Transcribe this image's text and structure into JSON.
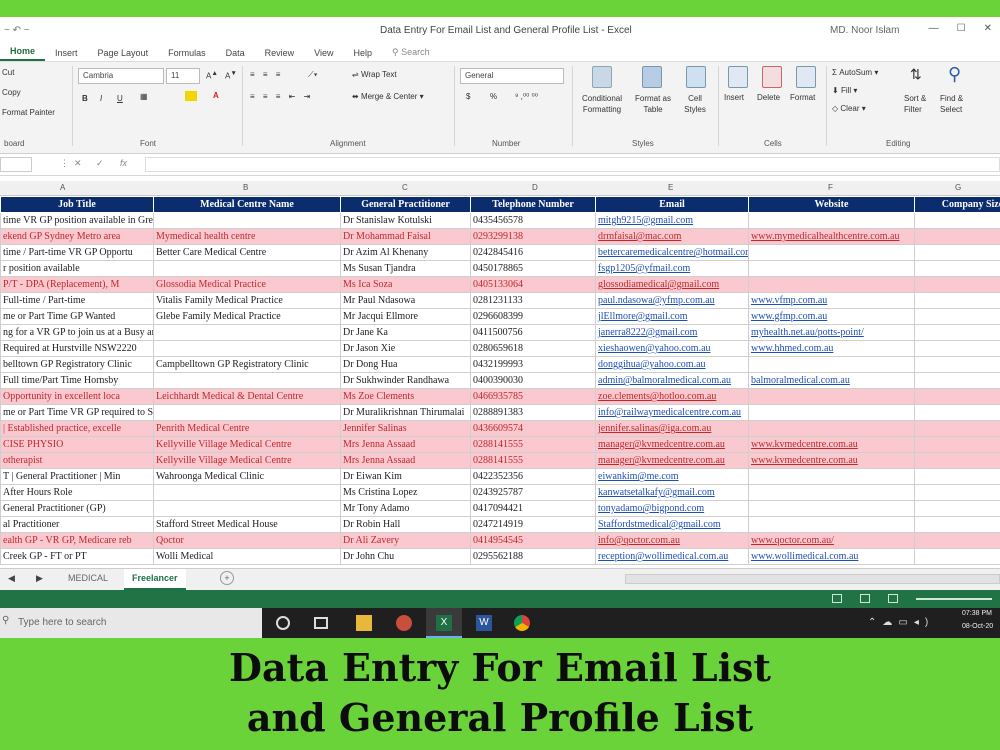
{
  "window": {
    "title": "Data Entry For Email List and General Profile List - Excel",
    "user": "MD. Noor Islam",
    "quick_access": "~ ↶ ~"
  },
  "tabs": [
    "Home",
    "Insert",
    "Page Layout",
    "Formulas",
    "Data",
    "Review",
    "View",
    "Help"
  ],
  "search_label": "Search",
  "ribbon": {
    "clipboard": {
      "cut": "Cut",
      "copy": "Copy",
      "format_painter": "Format Painter",
      "group": "board"
    },
    "font": {
      "name": "Cambria",
      "size": "11",
      "bold": "B",
      "italic": "I",
      "underline": "U",
      "group": "Font"
    },
    "alignment": {
      "wrap": "Wrap Text",
      "merge": "Merge & Center",
      "group": "Alignment"
    },
    "number": {
      "format": "General",
      "currency": "$",
      "percent": "%",
      "group": "Number"
    },
    "styles": {
      "conditional": "Conditional Formatting",
      "format_table": "Format as Table",
      "cell_styles": "Cell Styles",
      "group": "Styles"
    },
    "cells": {
      "insert": "Insert",
      "delete": "Delete",
      "format": "Format",
      "group": "Cells"
    },
    "editing": {
      "autosum": "AutoSum",
      "fill": "Fill",
      "clear": "Clear",
      "sort": "Sort & Filter",
      "find": "Find & Select",
      "group": "Editing"
    }
  },
  "formula_bar": {
    "fx": "fx",
    "cancel": "✕",
    "confirm": "✓"
  },
  "col_letters": [
    "A",
    "B",
    "C",
    "D",
    "E",
    "F",
    "G"
  ],
  "headers": [
    "Job Title",
    "Medical Centre Name",
    "General Practitioner",
    "Telephone Number",
    "Email",
    "Website",
    "Company Size"
  ],
  "rows": [
    {
      "pink": false,
      "cells": [
        "time VR GP position available in Greystanes NSW",
        "",
        "Dr Stanislaw Kotulski",
        "0435456578",
        "mitgh9215@gmail.com",
        "",
        ""
      ]
    },
    {
      "pink": true,
      "cells": [
        "ekend GP Sydney Metro area",
        "Mymedical health centre",
        "Dr Mohammad Faisal",
        "0293299138",
        "drmfaisal@mac.com",
        "www.mymedicalhealthcentre.com.au",
        ""
      ]
    },
    {
      "pink": false,
      "cells": [
        "time / Part-time VR GP Opportu",
        "Better Care Medical Centre",
        "Dr Azim Al Khenany",
        "0242845416",
        "bettercaremedicalcentre@hotmail.com",
        "",
        ""
      ]
    },
    {
      "pink": false,
      "cells": [
        "r position available",
        "",
        "Ms Susan Tjandra",
        "0450178865",
        "fsgp1205@yfmail.com",
        "",
        ""
      ]
    },
    {
      "pink": true,
      "cells": [
        "P/T - DPA (Replacement), M",
        "Glossodia Medical Practice",
        "Ms Ica Soza",
        "0405133064",
        "glossodiamedical@gmail.com",
        "",
        ""
      ]
    },
    {
      "pink": false,
      "cells": [
        "Full-time / Part-time",
        "Vitalis Family Medical Practice",
        "Mr Paul Ndasowa",
        "0281231133",
        "paul.ndasowa@yfmp.com.au",
        "www.vfmp.com.au",
        ""
      ]
    },
    {
      "pink": false,
      "cells": [
        "me or Part Time GP Wanted",
        "Glebe Family Medical Practice",
        "Mr Jacqui Ellmore",
        "0296608399",
        "jlEllmore@gmail.com",
        "www.gfmp.com.au",
        ""
      ]
    },
    {
      "pink": false,
      "cells": [
        "ng for a VR GP to join us at a Busy and Trendy Clinic in POTTS POIN",
        "",
        "Dr Jane Ka",
        "0411500756",
        "janerra8222@gmail.com",
        "myhealth.net.au/potts-point/",
        ""
      ]
    },
    {
      "pink": false,
      "cells": [
        "Required at Hurstville NSW2220",
        "",
        "Dr Jason Xie",
        "0280659618",
        "xieshaowen@yahoo.com.au",
        "www.hhmed.com.au",
        ""
      ]
    },
    {
      "pink": false,
      "cells": [
        "belltown GP Registratory Clinic",
        "Campbelltown GP Registratory Clinic",
        "Dr Dong Hua",
        "0432199993",
        "donggihua@yahoo.com.au",
        "",
        ""
      ]
    },
    {
      "pink": false,
      "cells": [
        "Full time/Part Time Hornsby",
        "",
        "Dr Sukhwinder Randhawa",
        "0400390030",
        "admin@balmoralmedical.com.au",
        "balmoralmedical.com.au",
        ""
      ]
    },
    {
      "pink": true,
      "cells": [
        "Opportunity in excellent loca",
        "Leichhardt Medical & Dental Centre",
        "Ms Zoe Clements",
        "0466935785",
        "zoe.clements@hotloo.com.au",
        "",
        ""
      ]
    },
    {
      "pink": false,
      "cells": [
        "me or Part Time VR GP required to Start Immediately",
        "",
        "Dr Muralikrishnan Thirumalai",
        "0288891383",
        "info@railwaymedicalcentre.com.au",
        "",
        ""
      ]
    },
    {
      "pink": true,
      "cells": [
        "| Established practice, excelle",
        "Penrith Medical Centre",
        "Jennifer Salinas",
        "0436609574",
        "jennifer.salinas@iga.com.au",
        "",
        ""
      ]
    },
    {
      "pink": true,
      "cells": [
        "CISE PHYSIO",
        "Kellyville Village Medical Centre",
        "Mrs Jenna Assaad",
        "0288141555",
        "manager@kvmedcentre.com.au",
        "www.kvmedcentre.com.au",
        ""
      ]
    },
    {
      "pink": true,
      "cells": [
        "otherapist",
        "Kellyville Village Medical Centre",
        "Mrs Jenna Assaad",
        "0288141555",
        "manager@kvmedcentre.com.au",
        "www.kvmedcentre.com.au",
        ""
      ]
    },
    {
      "pink": false,
      "cells": [
        "T | General Practitioner | Min",
        "Wahroonga Medical Clinic",
        "Dr Eiwan Kim",
        "0422352356",
        "eiwankim@me.com",
        "",
        ""
      ]
    },
    {
      "pink": false,
      "cells": [
        "After Hours Role",
        "",
        "Ms Cristina Lopez",
        "0243925787",
        "kanwatsetalkafy@gmail.com",
        "",
        ""
      ]
    },
    {
      "pink": false,
      "cells": [
        "General Practitioner (GP)",
        "",
        "Mr Tony Adamo",
        "0417094421",
        "tonyadamo@bigpond.com",
        "",
        ""
      ]
    },
    {
      "pink": false,
      "cells": [
        "al Practitioner",
        "Stafford Street Medical House",
        "Dr Robin Hall",
        "0247214919",
        "Staffordstmedical@gmail.com",
        "",
        ""
      ]
    },
    {
      "pink": true,
      "cells": [
        "ealth GP - VR GP, Medicare reb",
        "Qoctor",
        "Dr Ali Zavery",
        "0414954545",
        "info@qoctor.com.au",
        "www.qoctor.com.au/",
        ""
      ]
    },
    {
      "pink": false,
      "cells": [
        "Creek GP - FT or PT",
        "Wolli Medical",
        "Dr John Chu",
        "0295562188",
        "reception@wollimedical.com.au",
        "www.wollimedical.com.au",
        ""
      ]
    }
  ],
  "sheets": [
    "MEDICAL",
    "Freelancer"
  ],
  "taskbar": {
    "search_placeholder": "Type here to search",
    "time": "07:38 PM",
    "date": "08-Oct-20"
  },
  "caption": {
    "line1": "Data Entry For Email List",
    "line2": "and General Profile List"
  }
}
